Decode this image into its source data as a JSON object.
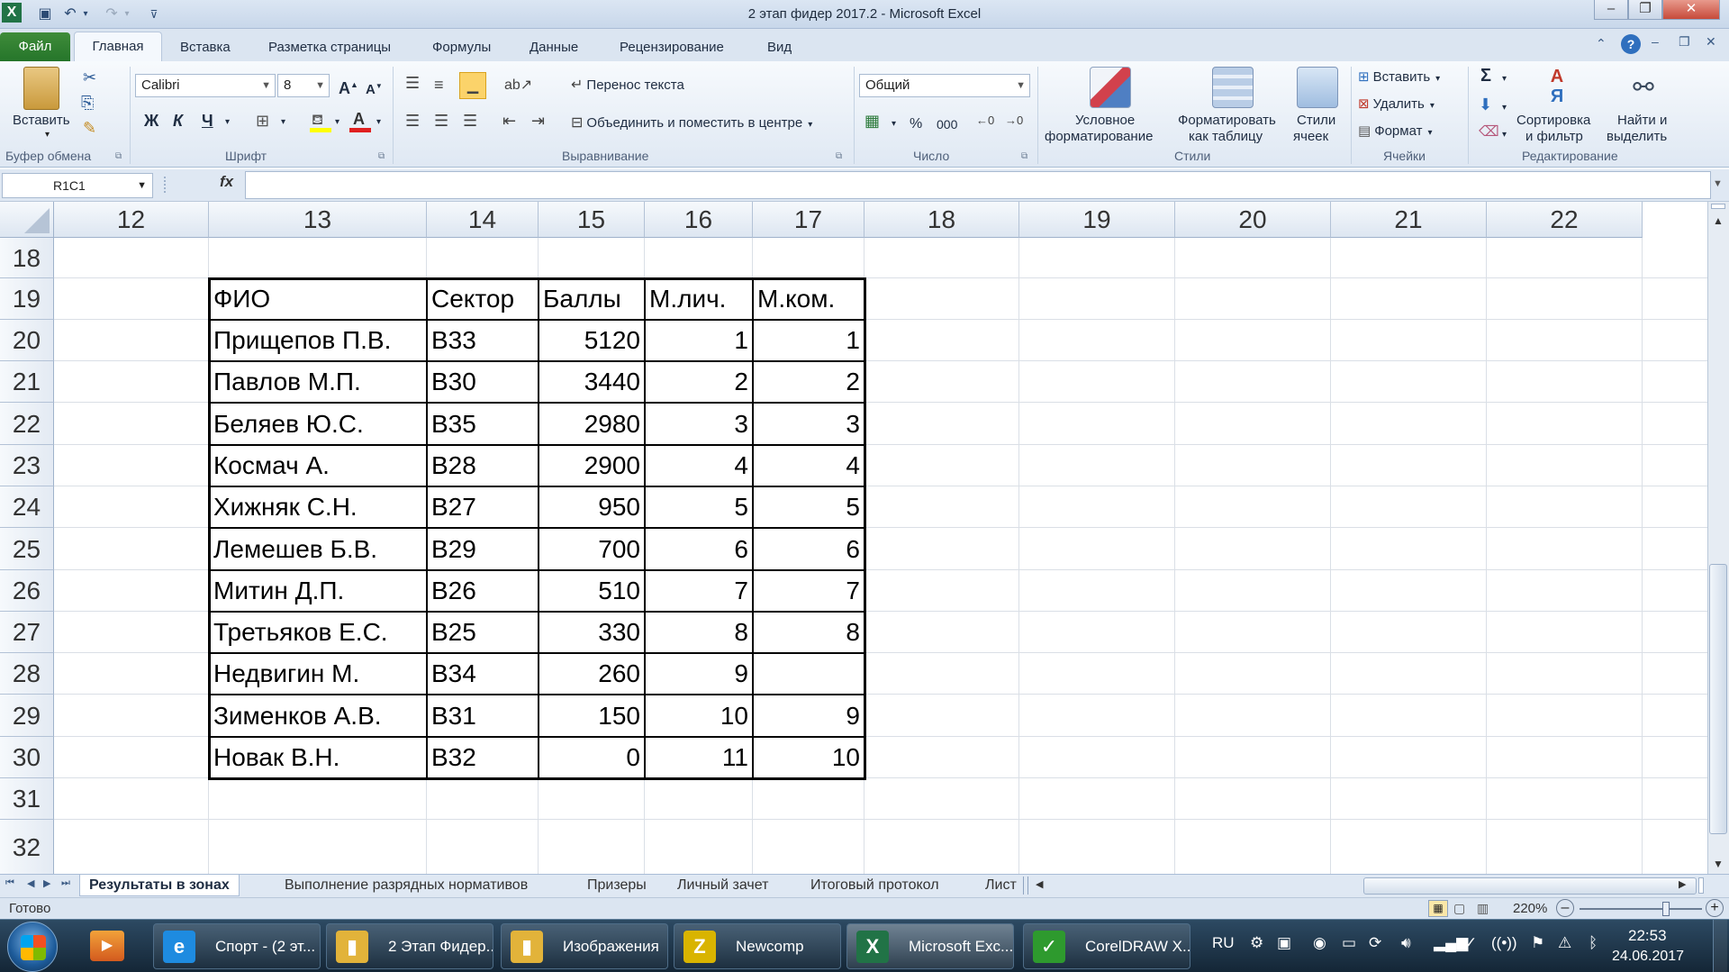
{
  "window": {
    "title": "2 этап фидер 2017.2  -  Microsoft Excel"
  },
  "tabs": {
    "file": "Файл",
    "home": "Главная",
    "insert": "Вставка",
    "layout": "Разметка страницы",
    "formulas": "Формулы",
    "data": "Данные",
    "review": "Рецензирование",
    "view": "Вид"
  },
  "ribbon": {
    "clipboard": {
      "paste": "Вставить",
      "group": "Буфер обмена"
    },
    "font": {
      "name": "Calibri",
      "size": "8",
      "bold": "Ж",
      "italic": "К",
      "underline": "Ч",
      "group": "Шрифт"
    },
    "alignment": {
      "wrap": "Перенос текста",
      "merge": "Объединить и поместить в центре",
      "group": "Выравнивание"
    },
    "number": {
      "format": "Общий",
      "percent": "%",
      "thousands": "000",
      "group": "Число"
    },
    "styles": {
      "conditional_1": "Условное",
      "conditional_2": "форматирование",
      "as_table_1": "Форматировать",
      "as_table_2": "как таблицу",
      "cell_styles_1": "Стили",
      "cell_styles_2": "ячеек",
      "group": "Стили"
    },
    "cells": {
      "insert": "Вставить",
      "delete": "Удалить",
      "format": "Формат",
      "group": "Ячейки"
    },
    "editing": {
      "sort_1": "Сортировка",
      "sort_2": "и фильтр",
      "find_1": "Найти и",
      "find_2": "выделить",
      "group": "Редактирование"
    }
  },
  "formula_bar": {
    "name_box": "R1C1",
    "fx": "fx",
    "value": ""
  },
  "columns": [
    "12",
    "13",
    "14",
    "15",
    "16",
    "17",
    "18",
    "19",
    "20",
    "21",
    "22"
  ],
  "rows": [
    "18",
    "19",
    "20",
    "21",
    "22",
    "23",
    "24",
    "25",
    "26",
    "27",
    "28",
    "29",
    "30",
    "31",
    "32"
  ],
  "table": {
    "headers": [
      "ФИО",
      "Сектор",
      "Баллы",
      "М.лич.",
      "М.ком."
    ],
    "rows": [
      [
        "Прищепов П.В.",
        "В33",
        "5120",
        "1",
        "1"
      ],
      [
        "Павлов М.П.",
        "В30",
        "3440",
        "2",
        "2"
      ],
      [
        "Беляев Ю.С.",
        "В35",
        "2980",
        "3",
        "3"
      ],
      [
        "Космач А.",
        "В28",
        "2900",
        "4",
        "4"
      ],
      [
        "Хижняк С.Н.",
        "В27",
        "950",
        "5",
        "5"
      ],
      [
        "Лемешев Б.В.",
        "В29",
        "700",
        "6",
        "6"
      ],
      [
        "Митин Д.П.",
        "В26",
        "510",
        "7",
        "7"
      ],
      [
        "Третьяков Е.С.",
        "В25",
        "330",
        "8",
        "8"
      ],
      [
        "Недвигин М.",
        "В34",
        "260",
        "9",
        ""
      ],
      [
        "Зименков А.В.",
        "В31",
        "150",
        "10",
        "9"
      ],
      [
        "Новак В.Н.",
        "В32",
        "0",
        "11",
        "10"
      ]
    ]
  },
  "sheets": [
    "Результаты в зонах",
    "Выполнение разрядных нормативов",
    "Призеры",
    "Личный зачет",
    "Итоговый протокол",
    "Лист"
  ],
  "status": {
    "ready": "Готово",
    "zoom": "220%"
  },
  "taskbar": {
    "items": [
      {
        "label": "Спорт - (2 эт...",
        "icon": "e"
      },
      {
        "label": "2 Этап Фидер...",
        "icon": "▮"
      },
      {
        "label": "Изображения",
        "icon": "▮"
      },
      {
        "label": "Newcomp",
        "icon": "Z"
      },
      {
        "label": "Microsoft Exc...",
        "icon": "X"
      },
      {
        "label": "CorelDRAW X...",
        "icon": "✓"
      }
    ],
    "lang": "RU",
    "time": "22:53",
    "date": "24.06.2017"
  },
  "colors": {
    "excel_green": "#217346",
    "file_tab": "#2f7d32",
    "ribbon": "#dfe8f3",
    "taskbar": "#1c3448"
  }
}
